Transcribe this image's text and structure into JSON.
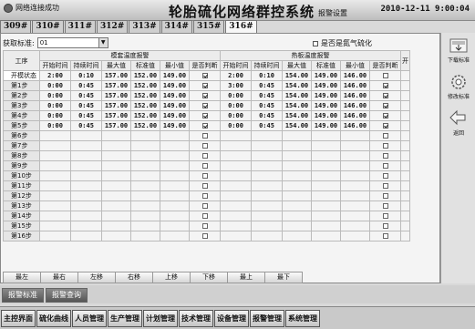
{
  "titlebar": {
    "status": "网络连接成功",
    "system_name": "轮胎硫化网络群控系统",
    "subtitle": "报警设置",
    "datetime": "2010-12-11 9:00:04"
  },
  "tabs": [
    "309#",
    "310#",
    "311#",
    "312#",
    "313#",
    "314#",
    "315#",
    "316#"
  ],
  "active_tab": "316#",
  "standard": {
    "label": "获取标准:",
    "value": "01"
  },
  "nitrogen": {
    "label": "是否是氮气硫化"
  },
  "table": {
    "corner": "工序",
    "group1": "模套温度报警",
    "group2": "热板温度报警",
    "columns": [
      "开始时间",
      "持续时间",
      "最大值",
      "标准值",
      "最小值",
      "是否判断"
    ],
    "overflow_col": "开",
    "rows": [
      {
        "label": "开模状态",
        "g1": [
          "2:00",
          "0:10",
          "157.00",
          "152.00",
          "149.00"
        ],
        "g1c": true,
        "g2": [
          "2:00",
          "0:10",
          "154.00",
          "149.00",
          "146.00"
        ],
        "g2c": false
      },
      {
        "label": "第1步",
        "g1": [
          "0:00",
          "0:45",
          "157.00",
          "152.00",
          "149.00"
        ],
        "g1c": true,
        "g2": [
          "3:00",
          "0:45",
          "154.00",
          "149.00",
          "146.00"
        ],
        "g2c": true
      },
      {
        "label": "第2步",
        "g1": [
          "0:00",
          "0:45",
          "157.00",
          "152.00",
          "149.00"
        ],
        "g1c": true,
        "g2": [
          "0:00",
          "0:45",
          "154.00",
          "149.00",
          "146.00"
        ],
        "g2c": true
      },
      {
        "label": "第3步",
        "g1": [
          "0:00",
          "0:45",
          "157.00",
          "152.00",
          "149.00"
        ],
        "g1c": true,
        "g2": [
          "0:00",
          "0:45",
          "154.00",
          "149.00",
          "146.00"
        ],
        "g2c": true
      },
      {
        "label": "第4步",
        "g1": [
          "0:00",
          "0:45",
          "157.00",
          "152.00",
          "149.00"
        ],
        "g1c": true,
        "g2": [
          "0:00",
          "0:45",
          "154.00",
          "149.00",
          "146.00"
        ],
        "g2c": true
      },
      {
        "label": "第5步",
        "g1": [
          "0:00",
          "0:45",
          "157.00",
          "152.00",
          "149.00"
        ],
        "g1c": true,
        "g2": [
          "0:00",
          "0:45",
          "154.00",
          "149.00",
          "146.00"
        ],
        "g2c": true
      },
      {
        "label": "第6步",
        "g1": [
          "",
          "",
          "",
          "",
          ""
        ],
        "g1c": false,
        "g2": [
          "",
          "",
          "",
          "",
          ""
        ],
        "g2c": false
      },
      {
        "label": "第7步",
        "g1": [
          "",
          "",
          "",
          "",
          ""
        ],
        "g1c": false,
        "g2": [
          "",
          "",
          "",
          "",
          ""
        ],
        "g2c": false
      },
      {
        "label": "第8步",
        "g1": [
          "",
          "",
          "",
          "",
          ""
        ],
        "g1c": false,
        "g2": [
          "",
          "",
          "",
          "",
          ""
        ],
        "g2c": false
      },
      {
        "label": "第9步",
        "g1": [
          "",
          "",
          "",
          "",
          ""
        ],
        "g1c": false,
        "g2": [
          "",
          "",
          "",
          "",
          ""
        ],
        "g2c": false
      },
      {
        "label": "第10步",
        "g1": [
          "",
          "",
          "",
          "",
          ""
        ],
        "g1c": false,
        "g2": [
          "",
          "",
          "",
          "",
          ""
        ],
        "g2c": false
      },
      {
        "label": "第11步",
        "g1": [
          "",
          "",
          "",
          "",
          ""
        ],
        "g1c": false,
        "g2": [
          "",
          "",
          "",
          "",
          ""
        ],
        "g2c": false
      },
      {
        "label": "第12步",
        "g1": [
          "",
          "",
          "",
          "",
          ""
        ],
        "g1c": false,
        "g2": [
          "",
          "",
          "",
          "",
          ""
        ],
        "g2c": false
      },
      {
        "label": "第13步",
        "g1": [
          "",
          "",
          "",
          "",
          ""
        ],
        "g1c": false,
        "g2": [
          "",
          "",
          "",
          "",
          ""
        ],
        "g2c": false
      },
      {
        "label": "第14步",
        "g1": [
          "",
          "",
          "",
          "",
          ""
        ],
        "g1c": false,
        "g2": [
          "",
          "",
          "",
          "",
          ""
        ],
        "g2c": false
      },
      {
        "label": "第15步",
        "g1": [
          "",
          "",
          "",
          "",
          ""
        ],
        "g1c": false,
        "g2": [
          "",
          "",
          "",
          "",
          ""
        ],
        "g2c": false
      },
      {
        "label": "第16步",
        "g1": [
          "",
          "",
          "",
          "",
          ""
        ],
        "g1c": false,
        "g2": [
          "",
          "",
          "",
          "",
          ""
        ],
        "g2c": false
      }
    ]
  },
  "nav": [
    "最左",
    "最右",
    "左移",
    "右移",
    "上移",
    "下移",
    "最上",
    "最下"
  ],
  "sidebar": {
    "download": "下载标准",
    "modify": "修改标准",
    "back": "返回"
  },
  "alarm_buttons": {
    "standard": "报警标准",
    "query": "报警查询"
  },
  "menu": [
    "主控界面",
    "硫化曲线",
    "人员管理",
    "生产管理",
    "计划管理",
    "技术管理",
    "设备管理",
    "报警管理",
    "系统管理"
  ]
}
